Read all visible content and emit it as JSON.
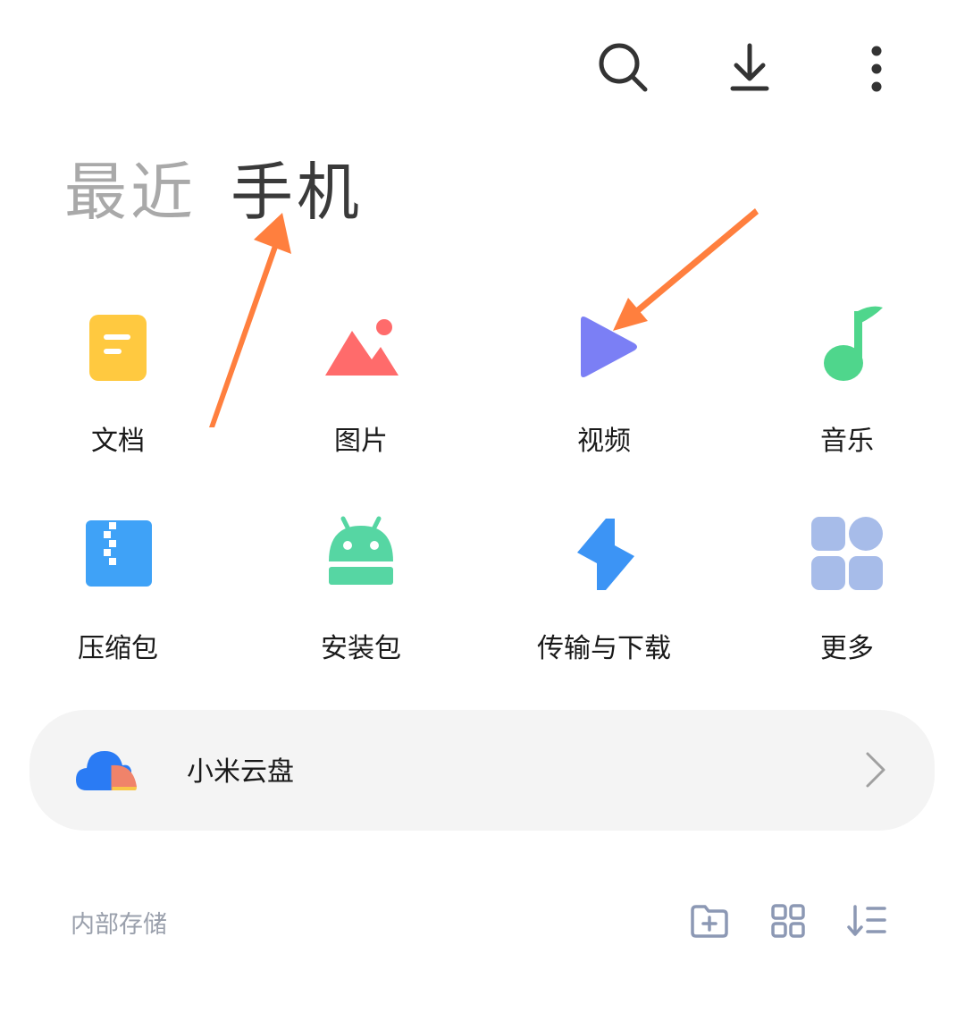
{
  "toolbar": {
    "icons": [
      "search-icon",
      "download-icon",
      "more-vert-icon"
    ],
    "icon_color": "#333333"
  },
  "tabs": [
    {
      "label": "最近",
      "active": false
    },
    {
      "label": "手机",
      "active": true
    }
  ],
  "categories": [
    {
      "label": "文档",
      "icon": "document-icon",
      "color": "#FFC940"
    },
    {
      "label": "图片",
      "icon": "image-icon",
      "color": "#FF6B6B"
    },
    {
      "label": "视频",
      "icon": "video-icon",
      "color": "#7B7FF5"
    },
    {
      "label": "音乐",
      "icon": "music-icon",
      "color": "#4FD68C"
    },
    {
      "label": "压缩包",
      "icon": "archive-icon",
      "color": "#3FA2F7"
    },
    {
      "label": "安装包",
      "icon": "android-icon",
      "color": "#56D6A3"
    },
    {
      "label": "传输与下载",
      "icon": "transfer-icon",
      "color": "#3C94F5"
    },
    {
      "label": "更多",
      "icon": "more-grid-icon",
      "color": "#A7BCE9"
    }
  ],
  "cloud": {
    "label": "小米云盘",
    "icon": "cloud-icon"
  },
  "storage": {
    "title": "内部存储",
    "actions": [
      "new-folder-icon",
      "grid-view-icon",
      "sort-icon"
    ]
  },
  "annotation_color": "#FF7F3E"
}
